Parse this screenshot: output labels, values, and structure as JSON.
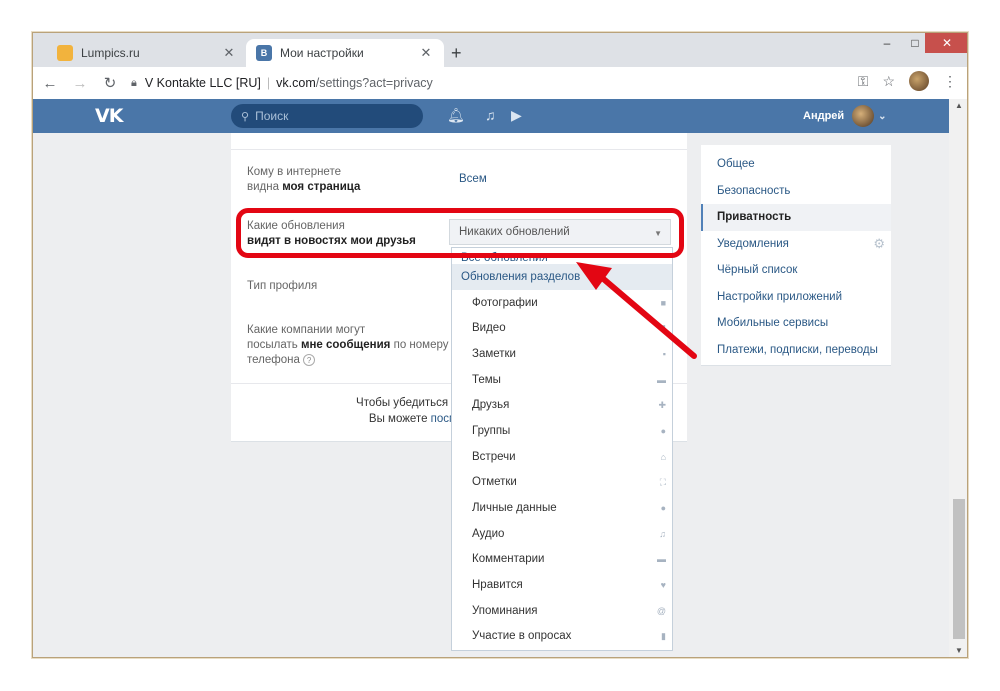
{
  "browser": {
    "tabs": [
      {
        "title": "Lumpics.ru",
        "active": false
      },
      {
        "title": "Мои настройки",
        "active": true
      }
    ],
    "new_tab": "+",
    "window_controls": {
      "minimize": "‒",
      "maximize": "□",
      "close": "✕"
    },
    "address": {
      "site": "V Kontakte LLC [RU]",
      "host": "vk.com",
      "path": "/settings?act=privacy"
    }
  },
  "vk": {
    "logo": "VK",
    "search_placeholder": "Поиск",
    "user_name": "Андрей"
  },
  "privacy": {
    "rows": [
      {
        "label_plain": "Кому в интернете",
        "label_bold": "видна моя страница",
        "value": "Всем"
      },
      {
        "label_plain": "Какие обновления",
        "label_bold": "видят в новостях мои друзья",
        "value": "Никаких обновлений"
      },
      {
        "label_plain": "Тип профиля"
      },
      {
        "label_plain": "Какие компании могут",
        "label_line2_plain": "посылать",
        "label_bold": "мне сообщения",
        "label_line2_tail": "по номеру",
        "label_line3": "телефона",
        "help": "?"
      }
    ],
    "footer": {
      "line1": "Чтобы убедиться в том, что Вы устано",
      "line2_plain": "Вы можете",
      "line2_link": "посмотреть, как видят"
    }
  },
  "dropdown": {
    "cut_item": "Все обновления",
    "items": [
      {
        "label": "Обновления разделов",
        "sub": false,
        "icon": ""
      },
      {
        "label": "Фотографии",
        "sub": true,
        "icon": "■"
      },
      {
        "label": "Видео",
        "sub": true,
        "icon": "▮"
      },
      {
        "label": "Заметки",
        "sub": true,
        "icon": "▪"
      },
      {
        "label": "Темы",
        "sub": true,
        "icon": "▬"
      },
      {
        "label": "Друзья",
        "sub": true,
        "icon": "✚"
      },
      {
        "label": "Группы",
        "sub": true,
        "icon": "●"
      },
      {
        "label": "Встречи",
        "sub": true,
        "icon": "⌂"
      },
      {
        "label": "Отметки",
        "sub": true,
        "icon": "⛶"
      },
      {
        "label": "Личные данные",
        "sub": true,
        "icon": "●"
      },
      {
        "label": "Аудио",
        "sub": true,
        "icon": "♫"
      },
      {
        "label": "Комментарии",
        "sub": true,
        "icon": "▬"
      },
      {
        "label": "Нравится",
        "sub": true,
        "icon": "♥"
      },
      {
        "label": "Упоминания",
        "sub": true,
        "icon": "@"
      },
      {
        "label": "Участие в опросах",
        "sub": true,
        "icon": "▮"
      }
    ]
  },
  "settings_menu": [
    {
      "label": "Общее",
      "active": false
    },
    {
      "label": "Безопасность",
      "active": false
    },
    {
      "label": "Приватность",
      "active": true
    },
    {
      "label": "Уведомления",
      "active": false
    },
    {
      "label": "Чёрный список",
      "active": false
    },
    {
      "label": "Настройки приложений",
      "active": false
    },
    {
      "label": "Мобильные сервисы",
      "active": false
    },
    {
      "label": "Платежи, подписки, переводы",
      "active": false
    }
  ],
  "colors": {
    "accent": "#4a76a8",
    "highlight": "#e30613"
  }
}
